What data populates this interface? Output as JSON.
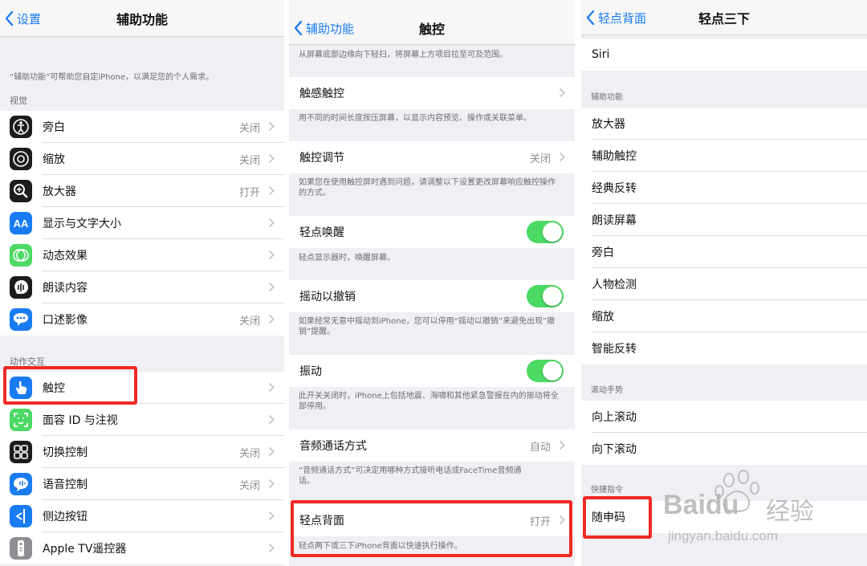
{
  "panel1": {
    "back": "设置",
    "title": "辅助功能",
    "intro": "“辅助功能”可帮助您自定iPhone，以满足您的个人需求。",
    "section_vision": "视觉",
    "section_interaction": "动作交互",
    "items": [
      {
        "label": "旁白",
        "value": "关闭",
        "icon": "voiceover-icon"
      },
      {
        "label": "缩放",
        "value": "关闭",
        "icon": "zoom-icon"
      },
      {
        "label": "放大器",
        "value": "打开",
        "icon": "magnifier-icon"
      },
      {
        "label": "显示与文字大小",
        "value": "",
        "icon": "text-size-icon",
        "glyph": "AA"
      },
      {
        "label": "动态效果",
        "value": "",
        "icon": "motion-icon"
      },
      {
        "label": "朗读内容",
        "value": "",
        "icon": "spoken-content-icon"
      },
      {
        "label": "口述影像",
        "value": "关闭",
        "icon": "audio-description-icon"
      },
      {
        "label": "触控",
        "value": "",
        "icon": "touch-icon"
      },
      {
        "label": "面容 ID 与注视",
        "value": "",
        "icon": "face-id-icon"
      },
      {
        "label": "切换控制",
        "value": "关闭",
        "icon": "switch-control-icon"
      },
      {
        "label": "语音控制",
        "value": "关闭",
        "icon": "voice-control-icon"
      },
      {
        "label": "侧边按钮",
        "value": "",
        "icon": "side-button-icon"
      },
      {
        "label": "Apple TV遥控器",
        "value": "",
        "icon": "apple-tv-remote-icon"
      }
    ]
  },
  "panel2": {
    "back": "辅助功能",
    "title": "触控",
    "top_note": "从屏幕底部边缘向下轻扫，将屏幕上方项目拉至可及范围。",
    "haptic": {
      "label": "触感触控",
      "note": "用不同的时间长度按压屏幕，以显示内容预览、操作或关联菜单。"
    },
    "accommodations": {
      "label": "触控调节",
      "value": "关闭",
      "note": "如果您在使用触控屏时遇到问题，请调整以下设置更改屏幕响应触控操作的方式。"
    },
    "tap_wake": {
      "label": "轻点唤醒",
      "note": "轻点显示器时，唤醒屏幕。"
    },
    "shake_undo": {
      "label": "摇动以撤销",
      "note": "如果经常无意中摇动到iPhone，您可以停用“摇动以撤销”来避免出现“撤销”提醒。"
    },
    "vibration": {
      "label": "振动",
      "note": "此开关关闭时，iPhone上包括地震、海啸和其他紧急警报在内的振动将全部停用。"
    },
    "call_routing": {
      "label": "音频通话方式",
      "value": "自动",
      "note": "“音频通话方式”可决定用哪种方式接听电话或FaceTime音频通话。"
    },
    "back_tap": {
      "label": "轻点背面",
      "value": "打开",
      "note": "轻点两下或三下iPhone背面以快速执行操作。"
    }
  },
  "panel3": {
    "back": "轻点背面",
    "title": "轻点三下",
    "siri": "Siri",
    "section_accessibility": "辅助功能",
    "accessibility_items": [
      "放大器",
      "辅助触控",
      "经典反转",
      "朗读屏幕",
      "旁白",
      "人物检测",
      "缩放",
      "智能反转"
    ],
    "section_scroll": "滚动手势",
    "scroll_items": [
      "向上滚动",
      "向下滚动"
    ],
    "section_shortcuts": "快捷指令",
    "shortcut_items": [
      "随申码"
    ]
  },
  "watermark": {
    "brand": "Baidu",
    "brand_cn": "经验",
    "url": "jingyan.baidu.com"
  },
  "colors": {
    "accent": "#1a7cf2",
    "toggle_on": "#4cd964",
    "highlight": "#ee2a24"
  }
}
